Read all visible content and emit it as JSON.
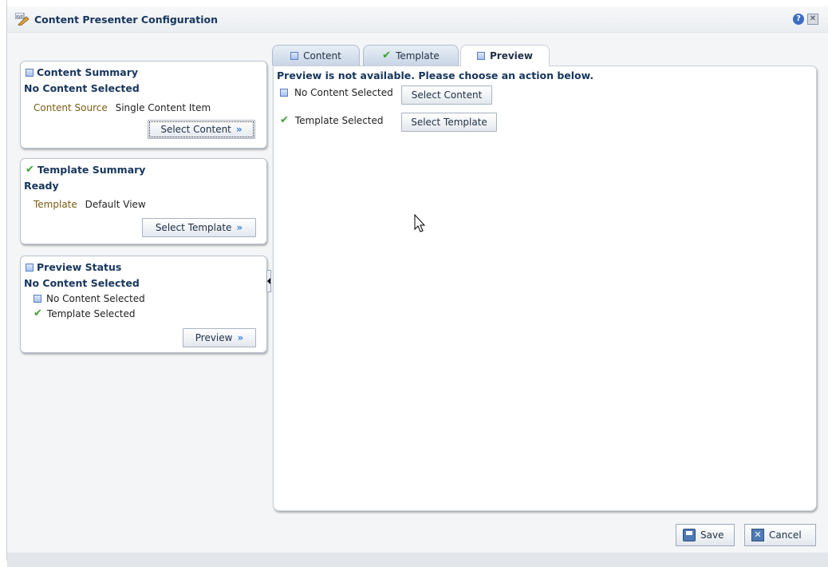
{
  "window": {
    "title": "Content Presenter Configuration",
    "help_glyph": "?",
    "close_glyph": "✕"
  },
  "left": {
    "content_summary": {
      "title": "Content Summary",
      "status": "No Content Selected",
      "source_label": "Content Source",
      "source_value": "Single Content Item",
      "button": "Select Content"
    },
    "template_summary": {
      "title": "Template Summary",
      "status": "Ready",
      "template_label": "Template",
      "template_value": "Default View",
      "button": "Select Template"
    },
    "preview_status": {
      "title": "Preview Status",
      "status": "No Content Selected",
      "item_content": "No Content Selected",
      "item_template": "Template Selected",
      "button": "Preview"
    }
  },
  "tabs": [
    {
      "label": "Content",
      "icon": "square-icon",
      "active": false
    },
    {
      "label": "Template",
      "icon": "check-icon",
      "active": false
    },
    {
      "label": "Preview",
      "icon": "square-icon",
      "active": true
    }
  ],
  "preview": {
    "message": "Preview is not available. Please choose an action below.",
    "row_content_label": "No Content Selected",
    "row_content_button": "Select Content",
    "row_template_label": "Template Selected",
    "row_template_button": "Select Template"
  },
  "footer": {
    "save": "Save",
    "cancel": "Cancel"
  },
  "colors": {
    "title_blue": "#17365d",
    "label_brown": "#7a5b14",
    "check_green": "#38a22b"
  }
}
